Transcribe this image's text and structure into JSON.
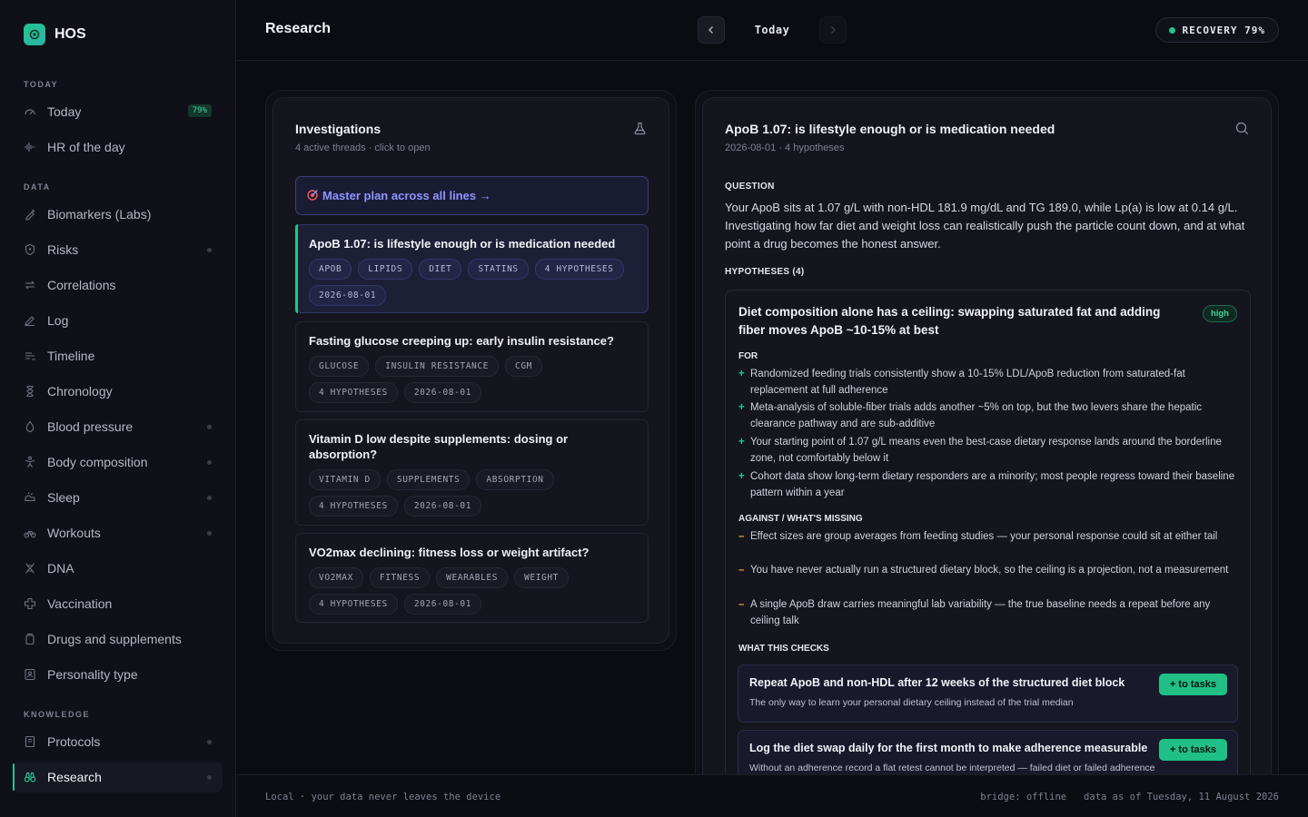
{
  "app": {
    "name": "HOS"
  },
  "sidebar": {
    "sections": [
      {
        "label": "TODAY",
        "items": [
          {
            "label": "Today",
            "icon": "gauge-icon",
            "badge": "79%"
          },
          {
            "label": "HR of the day",
            "icon": "heartbeat-icon"
          }
        ]
      },
      {
        "label": "DATA",
        "items": [
          {
            "label": "Biomarkers (Labs)",
            "icon": "syringe-icon"
          },
          {
            "label": "Risks",
            "icon": "shield-icon",
            "dot": true
          },
          {
            "label": "Correlations",
            "icon": "arrows-icon"
          },
          {
            "label": "Log",
            "icon": "pencil-icon"
          },
          {
            "label": "Timeline",
            "icon": "timeline-icon"
          },
          {
            "label": "Chronology",
            "icon": "hourglass-icon"
          },
          {
            "label": "Blood pressure",
            "icon": "droplet-icon",
            "dot": true
          },
          {
            "label": "Body composition",
            "icon": "body-icon",
            "dot": true
          },
          {
            "label": "Sleep",
            "icon": "sleep-icon",
            "dot": true
          },
          {
            "label": "Workouts",
            "icon": "bike-icon",
            "dot": true
          },
          {
            "label": "DNA",
            "icon": "dna-icon"
          },
          {
            "label": "Vaccination",
            "icon": "cross-icon"
          },
          {
            "label": "Drugs and supplements",
            "icon": "pill-bottle-icon"
          },
          {
            "label": "Personality type",
            "icon": "id-card-icon"
          }
        ]
      },
      {
        "label": "KNOWLEDGE",
        "items": [
          {
            "label": "Protocols",
            "icon": "book-icon",
            "dot": true
          },
          {
            "label": "Research",
            "icon": "binoculars-icon",
            "dot": true,
            "active": true
          }
        ]
      }
    ]
  },
  "header": {
    "title": "Research",
    "date_label": "Today",
    "recovery": "RECOVERY 79%"
  },
  "investigations": {
    "title": "Investigations",
    "subtitle": "4 active threads · click to open",
    "master_plan": "Master plan across all lines →",
    "items": [
      {
        "title": "ApoB 1.07: is lifestyle enough or is medication needed",
        "tags": [
          "APOB",
          "LIPIDS",
          "DIET",
          "STATINS",
          "4 HYPOTHESES",
          "2026-08-01"
        ],
        "active": true
      },
      {
        "title": "Fasting glucose creeping up: early insulin resistance?",
        "tags": [
          "GLUCOSE",
          "INSULIN RESISTANCE",
          "CGM",
          "4 HYPOTHESES",
          "2026-08-01"
        ]
      },
      {
        "title": "Vitamin D low despite supplements: dosing or absorption?",
        "tags": [
          "VITAMIN D",
          "SUPPLEMENTS",
          "ABSORPTION",
          "4 HYPOTHESES",
          "2026-08-01"
        ]
      },
      {
        "title": "VO2max declining: fitness loss or weight artifact?",
        "tags": [
          "VO2MAX",
          "FITNESS",
          "WEARABLES",
          "WEIGHT",
          "4 HYPOTHESES",
          "2026-08-01"
        ]
      }
    ]
  },
  "detail": {
    "title": "ApoB 1.07: is lifestyle enough or is medication needed",
    "subtitle": "2026-08-01 · 4 hypotheses",
    "question_label": "QUESTION",
    "question": "Your ApoB sits at 1.07 g/L with non-HDL 181.9 mg/dL and TG 189.0, while Lp(a) is low at 0.14 g/L. Investigating how far diet and weight loss can realistically push the particle count down, and at what point a drug becomes the honest answer.",
    "hypotheses_label": "HYPOTHESES (4)",
    "hypothesis": {
      "title": "Diet composition alone has a ceiling: swapping saturated fat and adding fiber moves ApoB ~10-15% at best",
      "confidence": "high",
      "for_label": "FOR",
      "for": [
        "Randomized feeding trials consistently show a 10-15% LDL/ApoB reduction from saturated-fat replacement at full adherence",
        "Meta-analysis of soluble-fiber trials adds another ~5% on top, but the two levers share the hepatic clearance pathway and are sub-additive",
        "Your starting point of 1.07 g/L means even the best-case dietary response lands around the borderline zone, not comfortably below it",
        "Cohort data show long-term dietary responders are a minority; most people regress toward their baseline pattern within a year"
      ],
      "against_label": "AGAINST / WHAT'S MISSING",
      "against": [
        "Effect sizes are group averages from feeding studies — your personal response could sit at either tail",
        "You have never actually run a structured dietary block, so the ceiling is a projection, not a measurement",
        "A single ApoB draw carries meaningful lab variability — the true baseline needs a repeat before any ceiling talk"
      ],
      "checks_label": "WHAT THIS CHECKS",
      "checks": [
        {
          "title": "Repeat ApoB and non-HDL after 12 weeks of the structured diet block",
          "desc": "The only way to learn your personal dietary ceiling instead of the trial median",
          "button": "+ to tasks"
        },
        {
          "title": "Log the diet swap daily for the first month to make adherence measurable",
          "desc": "Without an adherence record a flat retest cannot be interpreted — failed diet or failed adherence",
          "button": "+ to tasks"
        }
      ]
    }
  },
  "footer": {
    "left": "Local · your data never leaves the device",
    "right": "bridge: offline   data as of Tuesday, 11 August 2026"
  },
  "colors": {
    "accent": "#22c58f",
    "master": "#8f94ff",
    "pro": "#22c58f",
    "con": "#e8a03a"
  }
}
